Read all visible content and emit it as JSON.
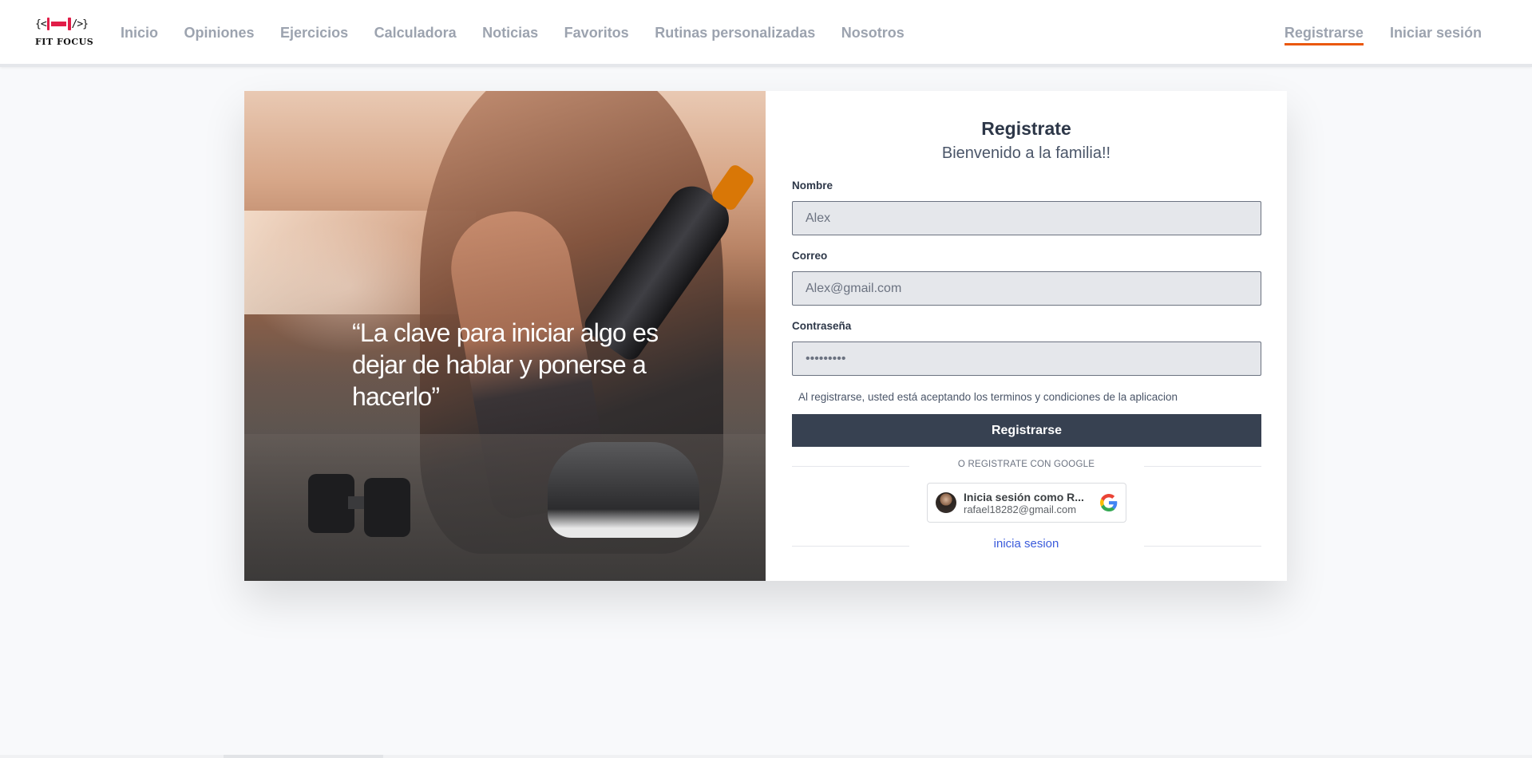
{
  "brand": {
    "logo_text": "FIT FOCUS",
    "logo_mark_left": "{<",
    "logo_mark_right": "/>}"
  },
  "nav": {
    "items": [
      {
        "label": "Inicio"
      },
      {
        "label": "Opiniones"
      },
      {
        "label": "Ejercicios"
      },
      {
        "label": "Calculadora"
      },
      {
        "label": "Noticias"
      },
      {
        "label": "Favoritos"
      },
      {
        "label": "Rutinas personalizadas"
      },
      {
        "label": "Nosotros"
      }
    ],
    "register": "Registrarse",
    "login": "Iniciar sesión",
    "active_item": "Registrarse",
    "active_underline_color": "#ea580c"
  },
  "hero": {
    "quote": "“La clave para iniciar algo es dejar de hablar y ponerse a hacerlo”"
  },
  "form": {
    "title": "Registrate",
    "subtitle": "Bienvenido a la familia!!",
    "name_label": "Nombre",
    "name_placeholder": "Alex",
    "email_label": "Correo",
    "email_placeholder": "Alex@gmail.com",
    "password_label": "Contraseña",
    "password_placeholder": "•••••••••",
    "terms": "Al registrarse, usted está aceptando los terminos y condiciones de la aplicacion",
    "submit": "Registrarse",
    "google_divider": "O REGISTRATE CON GOOGLE",
    "google": {
      "name": "Inicia sesión como R...",
      "email": "rafael18282@gmail.com",
      "icon": "google-g-icon"
    },
    "login_link": "inicia sesion",
    "button_color": "#374151",
    "link_color": "#3b5bdb"
  }
}
